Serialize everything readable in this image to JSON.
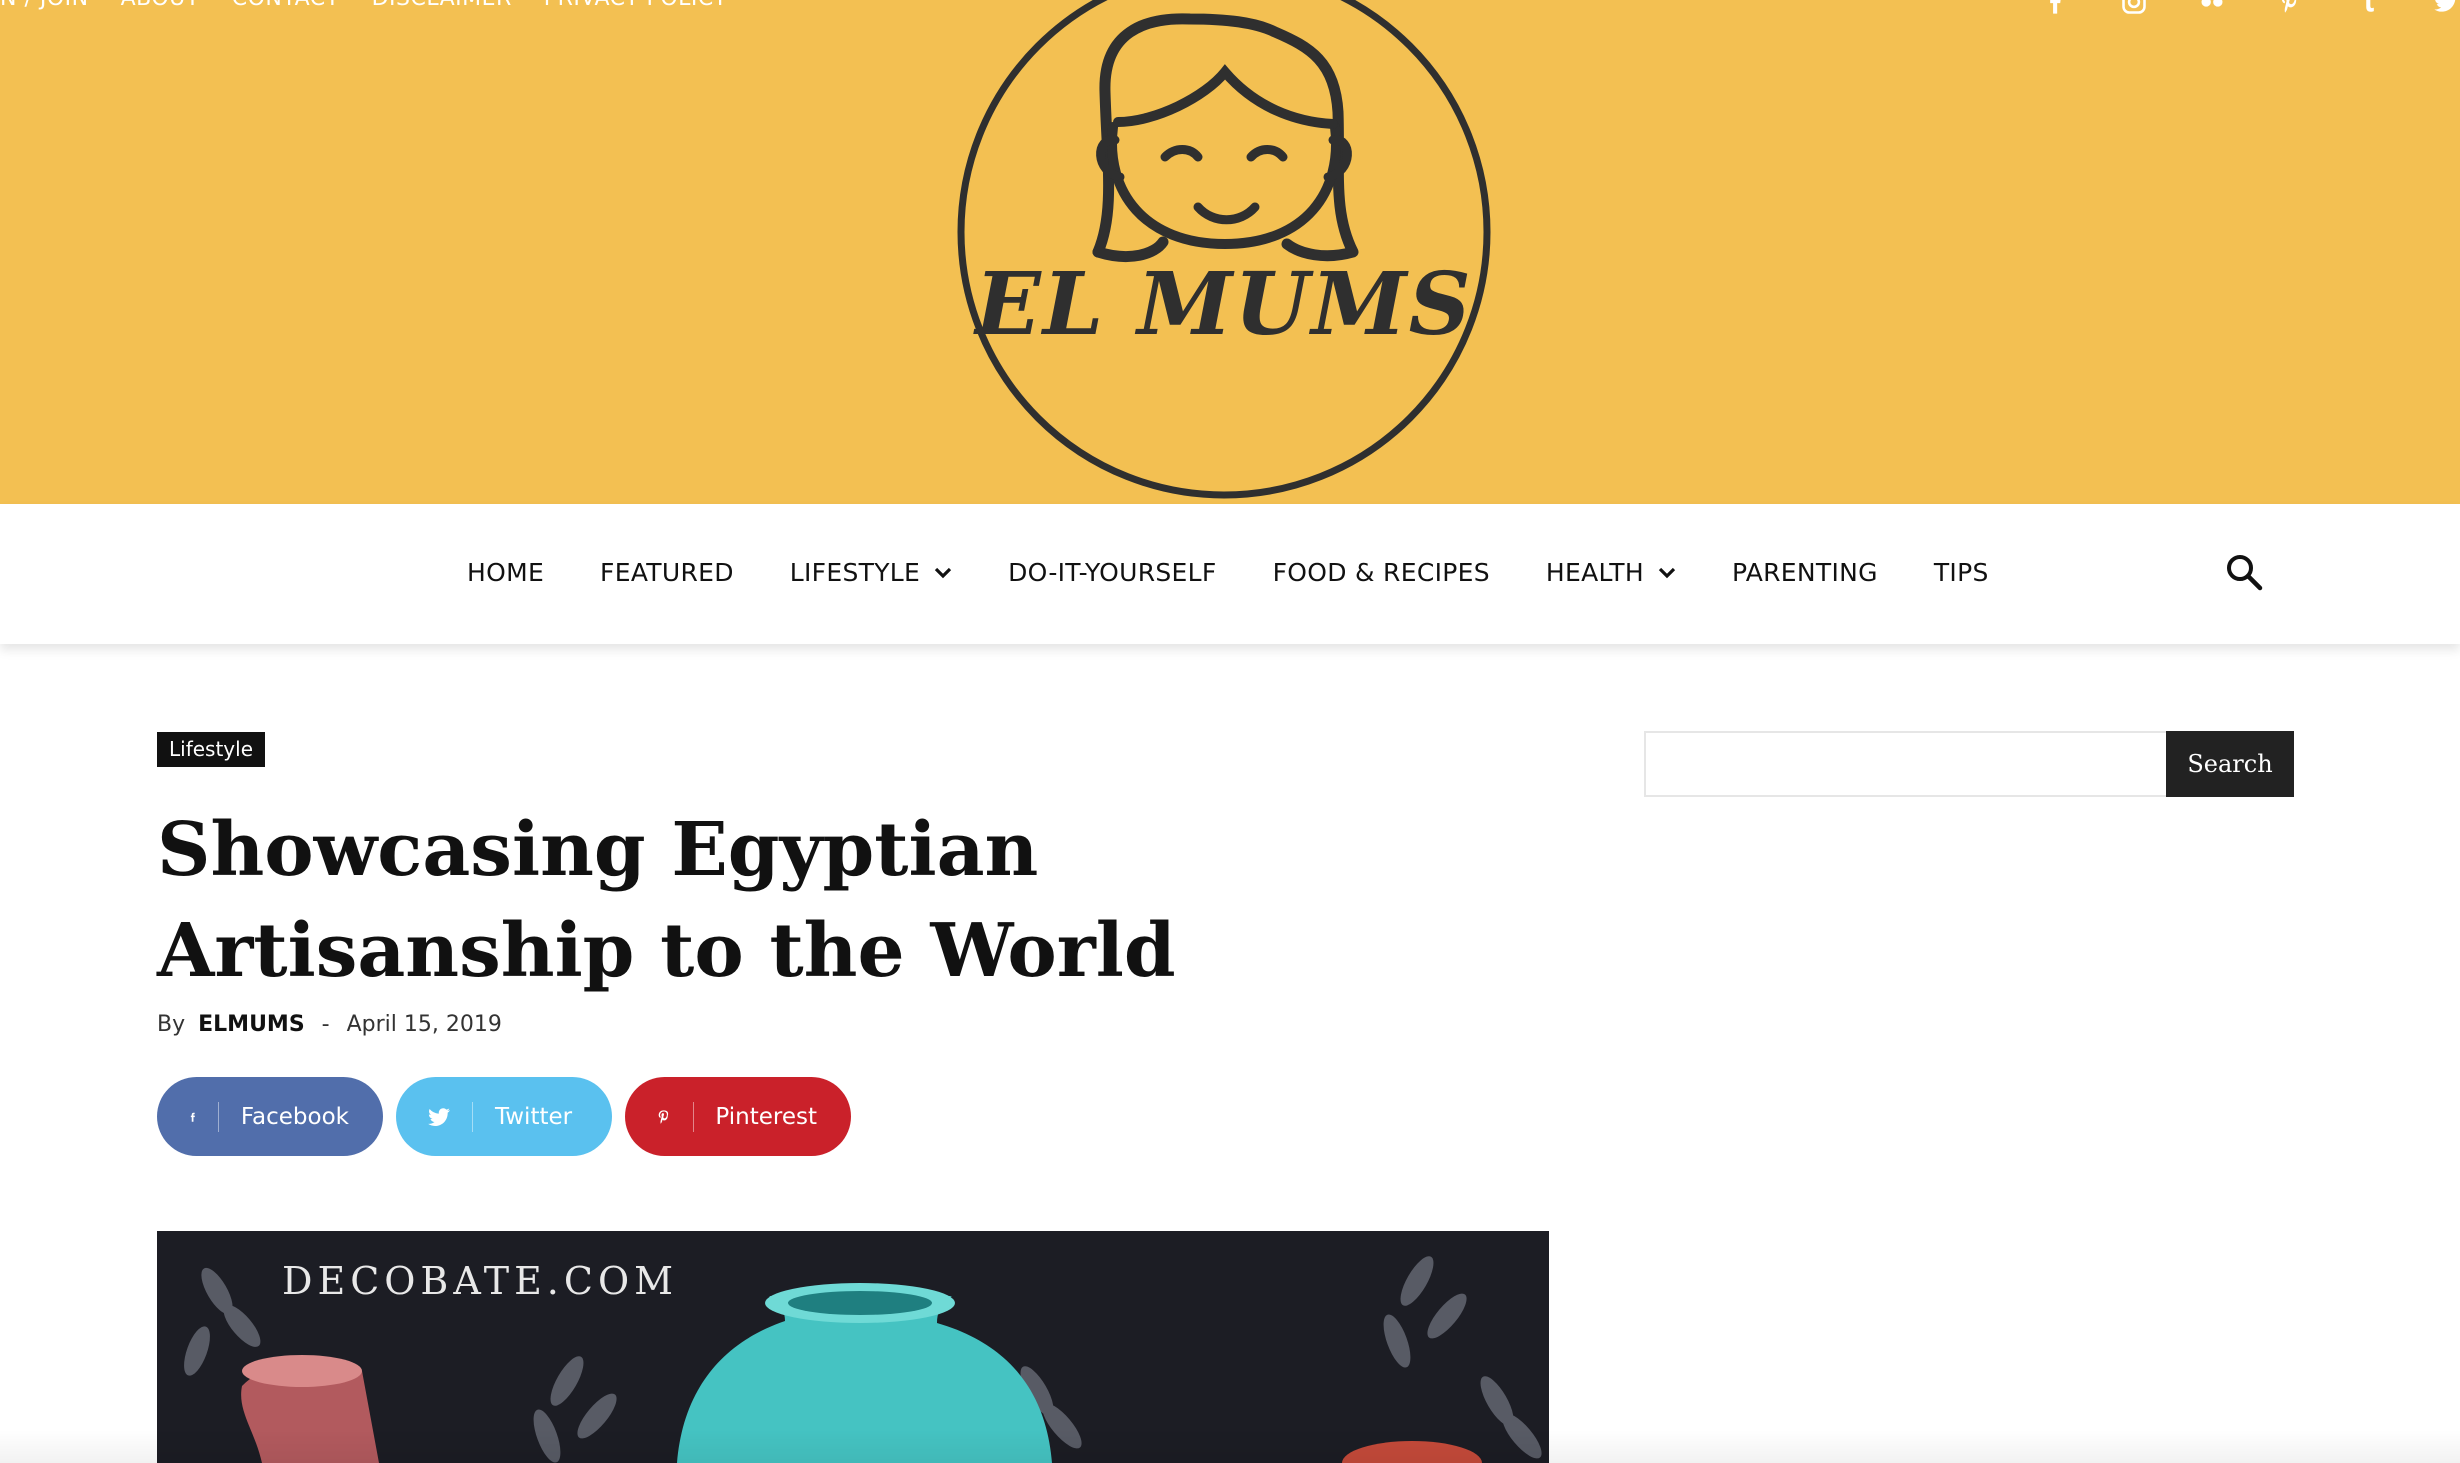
{
  "top_bar": {
    "links": [
      "N / JOIN",
      "ABOUT",
      "CONTACT",
      "DISCLAIMER",
      "PRIVACY POLICY"
    ],
    "social_icons": [
      "facebook-icon",
      "instagram-icon",
      "flickr-icon",
      "pinterest-icon",
      "tumblr-icon",
      "twitter-icon"
    ]
  },
  "brand": {
    "name": "EL MUMS",
    "accent_color": "#f3c052",
    "logo_ink_color": "#2f2f2f"
  },
  "nav": {
    "items": [
      {
        "label": "HOME",
        "dropdown": false
      },
      {
        "label": "FEATURED",
        "dropdown": false
      },
      {
        "label": "LIFESTYLE",
        "dropdown": true
      },
      {
        "label": "DO-IT-YOURSELF",
        "dropdown": false
      },
      {
        "label": "FOOD & RECIPES",
        "dropdown": false
      },
      {
        "label": "HEALTH",
        "dropdown": true
      },
      {
        "label": "PARENTING",
        "dropdown": false
      },
      {
        "label": "TIPS",
        "dropdown": false
      }
    ],
    "search_icon": "search-icon"
  },
  "article": {
    "category": "Lifestyle",
    "title": "Showcasing Egyptian Artisanship to the World",
    "byline_prefix": "By",
    "author": "ELMUMS",
    "separator": "-",
    "date": "April 15, 2019",
    "share": {
      "facebook": {
        "label": "Facebook",
        "color": "#516eab"
      },
      "twitter": {
        "label": "Twitter",
        "color": "#5ac1ef"
      },
      "pinterest": {
        "label": "Pinterest",
        "color": "#ca212a"
      }
    },
    "hero_caption": "DECOBATE.COM"
  },
  "sidebar": {
    "search": {
      "placeholder": "",
      "button_label": "Search"
    }
  }
}
